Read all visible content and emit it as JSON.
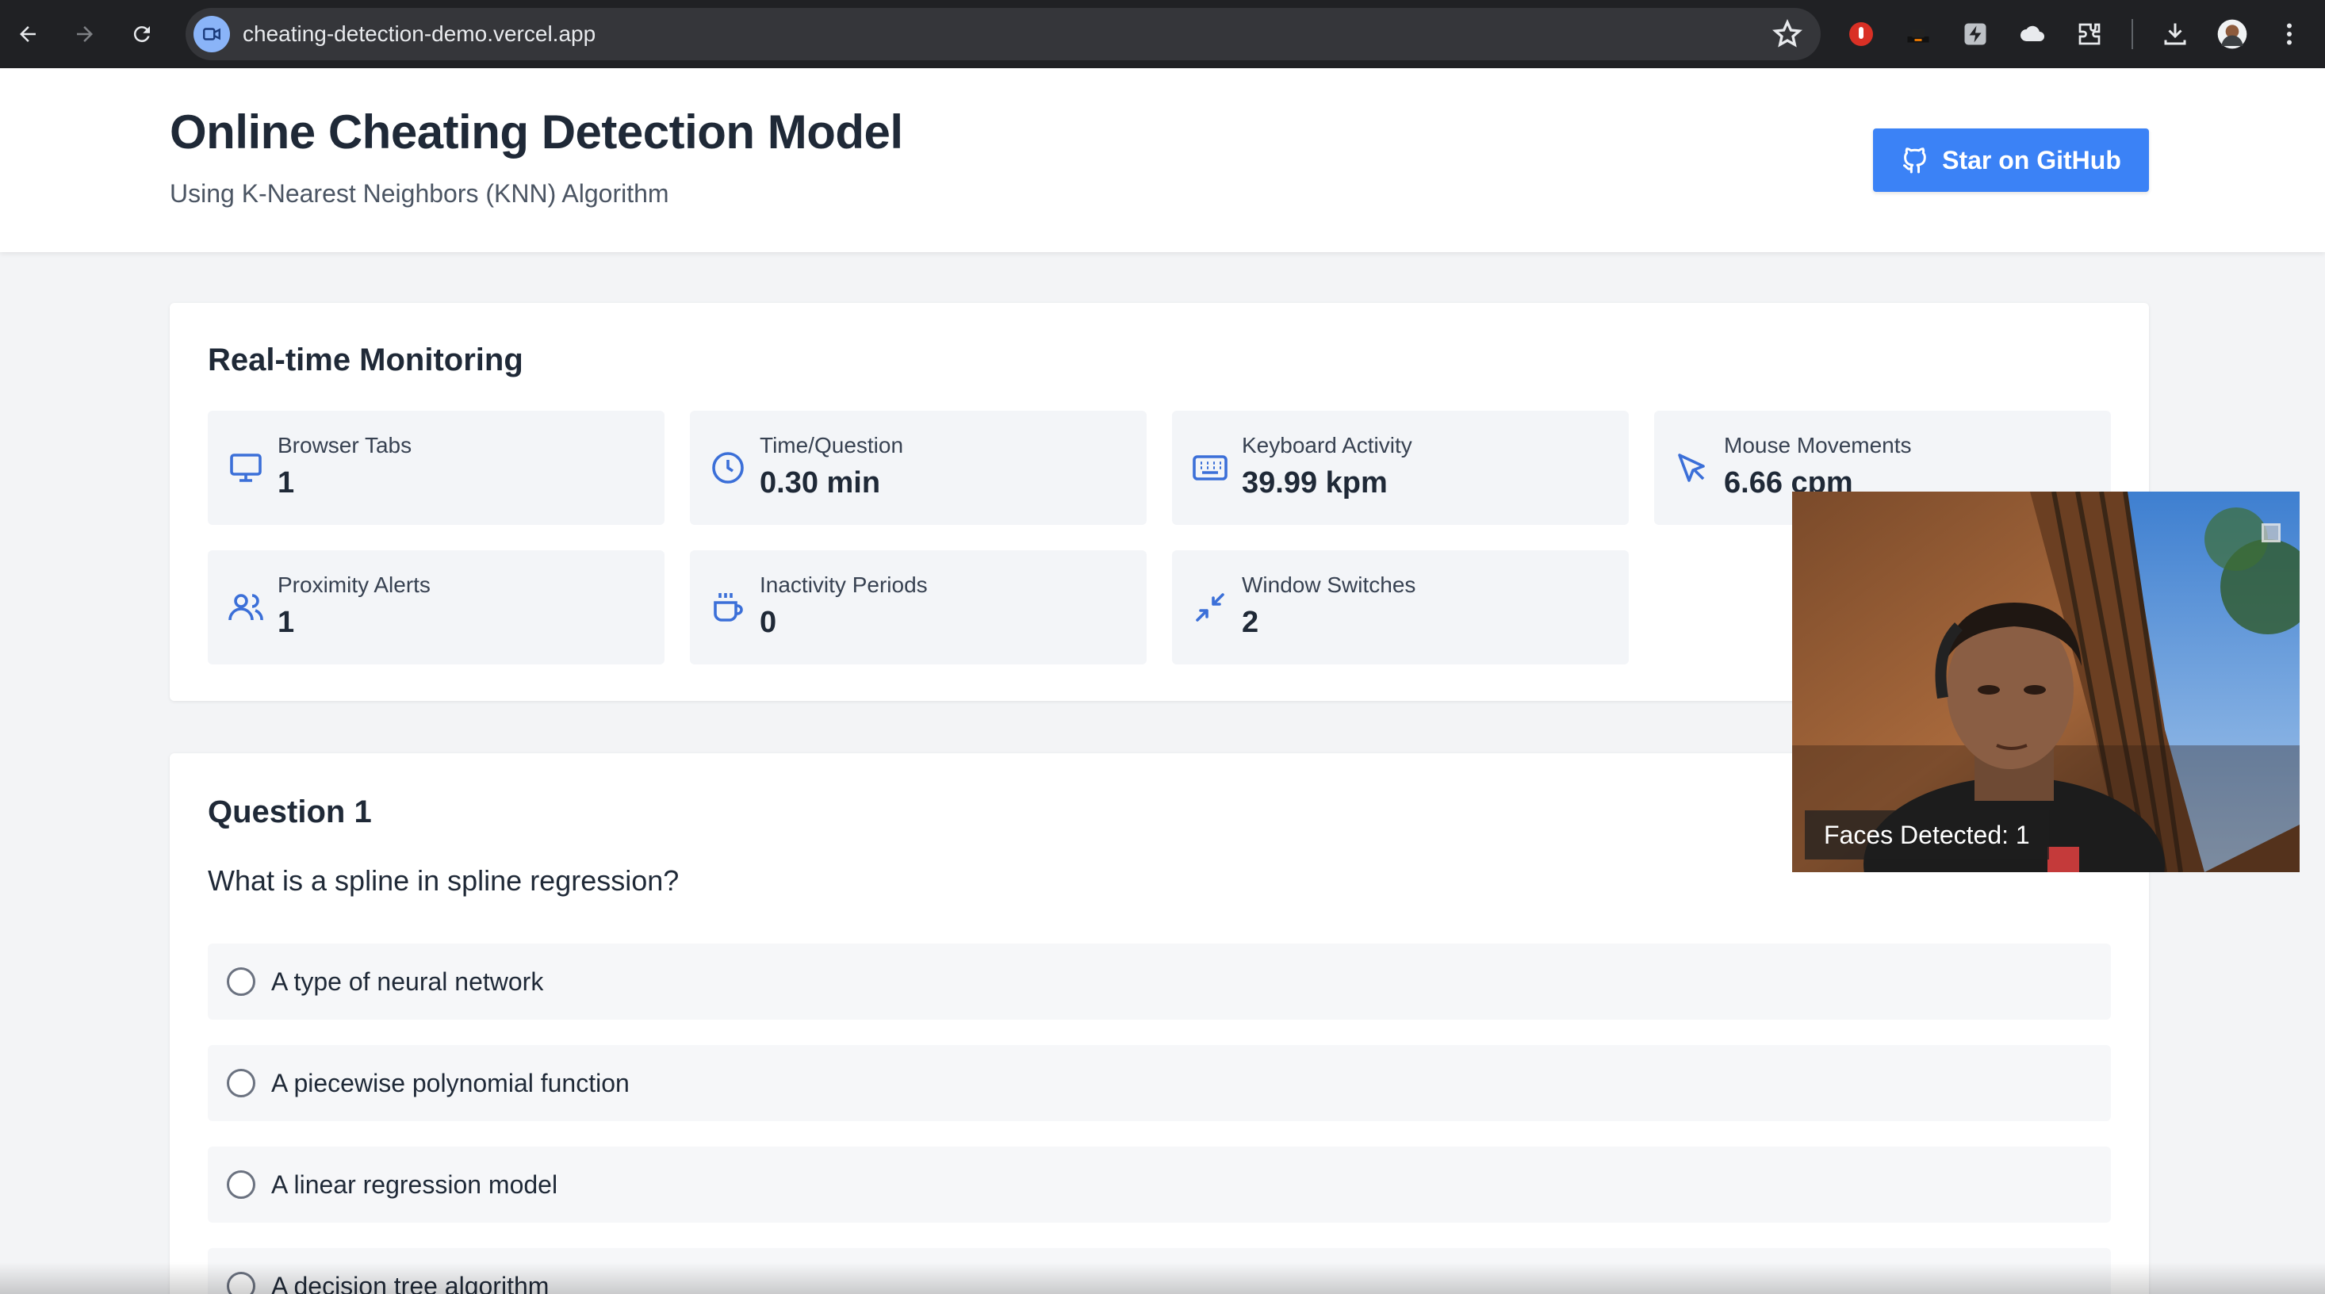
{
  "browser": {
    "url": "cheating-detection-demo.vercel.app"
  },
  "header": {
    "title": "Online Cheating Detection Model",
    "subtitle": "Using K-Nearest Neighbors (KNN) Algorithm",
    "github_button": "Star on GitHub"
  },
  "monitoring": {
    "title": "Real-time Monitoring",
    "stats": [
      {
        "label": "Browser Tabs",
        "value": "1",
        "icon": "monitor-icon"
      },
      {
        "label": "Time/Question",
        "value": "0.30 min",
        "icon": "clock-icon"
      },
      {
        "label": "Keyboard Activity",
        "value": "39.99 kpm",
        "icon": "keyboard-icon"
      },
      {
        "label": "Mouse Movements",
        "value": "6.66 cpm",
        "icon": "cursor-icon"
      },
      {
        "label": "Proximity Alerts",
        "value": "1",
        "icon": "users-icon"
      },
      {
        "label": "Inactivity Periods",
        "value": "0",
        "icon": "coffee-icon"
      },
      {
        "label": "Window Switches",
        "value": "2",
        "icon": "minimize-icon"
      }
    ]
  },
  "question": {
    "title": "Question 1",
    "text": "What is a spline in spline regression?",
    "options": [
      "A type of neural network",
      "A piecewise polynomial function",
      "A linear regression model",
      "A decision tree algorithm"
    ]
  },
  "webcam": {
    "faces_label": "Faces Detected: 1"
  },
  "colors": {
    "accent": "#3b82f6",
    "icon": "#3b6fd8",
    "chrome_bg": "#202124"
  }
}
